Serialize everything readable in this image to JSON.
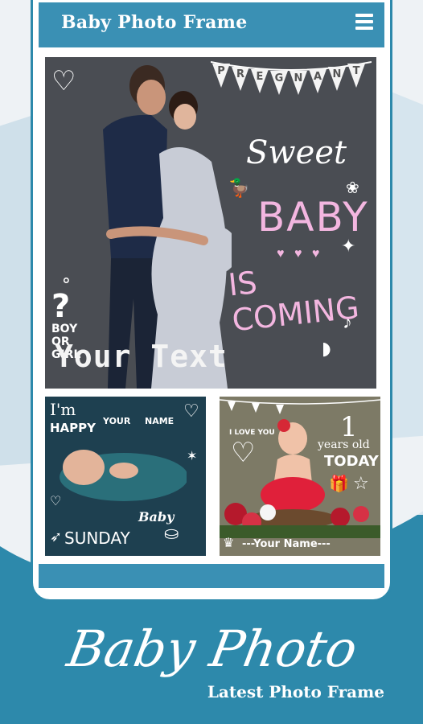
{
  "app": {
    "title": "Baby Photo Frame"
  },
  "main_frame": {
    "bunting_letters": [
      "P",
      "R",
      "E",
      "G",
      "N",
      "A",
      "N",
      "T"
    ],
    "sweet": "Sweet",
    "baby": "BABY",
    "coming": "IS COMING",
    "boy_girl": [
      "BOY",
      "OR",
      "GIRL"
    ],
    "your_text": "Your Text"
  },
  "thumb_left": {
    "im": "I'm",
    "happy": "HAPPY",
    "your": "YOUR",
    "name": "NAME",
    "baby": "Baby",
    "sunday": "SUNDAY"
  },
  "thumb_right": {
    "love_you": "I LOVE YOU",
    "one": "1",
    "years_old": "years old",
    "today": "TODAY",
    "your_name": "---Your Name---"
  },
  "banner": {
    "title": "Baby Photo",
    "subtitle": "Latest Photo Frame"
  },
  "colors": {
    "primary": "#3a90b4",
    "frame_bg": "#4a4d53",
    "pink": "#f3b6e0"
  }
}
